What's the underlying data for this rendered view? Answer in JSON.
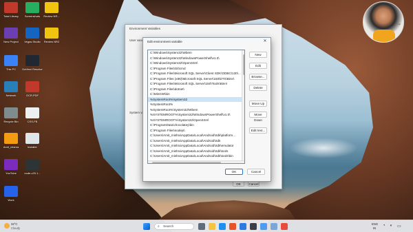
{
  "desktop": {
    "icons": [
      {
        "label": "Total Library",
        "color": "#c0392b"
      },
      {
        "label": "Screenshots",
        "color": "#27ae60"
      },
      {
        "label": "Review NR...",
        "color": "#f1c40f"
      },
      {
        "label": "New Project",
        "color": "#6c3fb0"
      },
      {
        "label": "Vegas Studio",
        "color": "#1565c0"
      },
      {
        "label": "Review NR2",
        "color": "#f1c40f"
      },
      {
        "label": "This PC",
        "color": "#3b82f6"
      },
      {
        "label": "DaVinci Resolve",
        "color": "#222831"
      },
      {
        "label": "Network",
        "color": "#2980b9"
      },
      {
        "label": "OCR.PDF",
        "color": "#c0392b"
      },
      {
        "label": "Recycle Bin",
        "color": "#7f8c8d"
      },
      {
        "label": "CSS-FB",
        "color": "#ecf0f1"
      },
      {
        "label": "Amit_mishra",
        "color": "#f39c12"
      },
      {
        "label": "installer",
        "color": "#dfe6e9"
      },
      {
        "label": "YouTube",
        "color": "#7b2cbf"
      },
      {
        "label": "node-v20.1...",
        "color": "#2d3436"
      },
      {
        "label": "Work",
        "color": "#2563eb"
      }
    ]
  },
  "webcam": {
    "tag": "imp"
  },
  "env_window": {
    "title": "Environment Variables",
    "user_section": "User variables for ...",
    "system_section": "System variables",
    "ok_label": "OK",
    "cancel_label": "Cancel"
  },
  "dialog": {
    "title": "Edit environment variable",
    "close_glyph": "✕",
    "entries": [
      "C:\\Windows\\System32\\Wbem",
      "C:\\Windows\\System32\\WindowsPowerShell\\v1.0\\",
      "C:\\Windows\\System32\\OpenSSH\\",
      "C:\\Program Files\\Git\\cmd",
      "C:\\Program Files\\Microsoft SQL Server\\Client SDK\\ODBC\\130\\...",
      "C:\\Program Files (x86)\\Microsoft SQL Server\\150\\DTS\\Binn\\",
      "C:\\Program Files\\Microsoft SQL Server\\150\\Tools\\Binn\\",
      "C:\\Program Files\\dotnet\\",
      "C:\\MinGW\\bin",
      "%SystemRoot%\\system32",
      "%SystemRoot%",
      "%SystemRoot%\\System32\\Wbem",
      "%SYSTEMROOT%\\System32\\WindowsPowerShell\\v1.0\\",
      "%SYSTEMROOT%\\System32\\OpenSSH\\",
      "C:\\ProgramData\\chocolatey\\bin",
      "C:\\Program Files\\nodejs\\",
      "C:\\Users\\Amit_mishra\\AppData\\Local\\Android\\Sdk\\platform...",
      "C:\\Users\\Amit_mishra\\AppData\\Local\\Android\\Sdk",
      "C:\\Users\\Amit_mishra\\AppData\\Local\\Android\\Sdk\\emulator",
      "C:\\Users\\Amit_mishra\\AppData\\Local\\Android\\Sdk\\tools",
      "C:\\Users\\Amit_mishra\\AppData\\Local\\Android\\Sdk\\tools\\bin"
    ],
    "buttons": {
      "new": "New",
      "edit": "Edit",
      "browse": "Browse...",
      "delete": "Delete",
      "move_up": "Move Up",
      "move_down": "Move Down",
      "edit_text": "Edit text...",
      "ok": "OK",
      "cancel": "Cancel"
    }
  },
  "taskbar": {
    "weather_temp": "32°C",
    "weather_desc": "Cloudy",
    "search_placeholder": "Search",
    "lang": "ENG",
    "region": "IN"
  }
}
